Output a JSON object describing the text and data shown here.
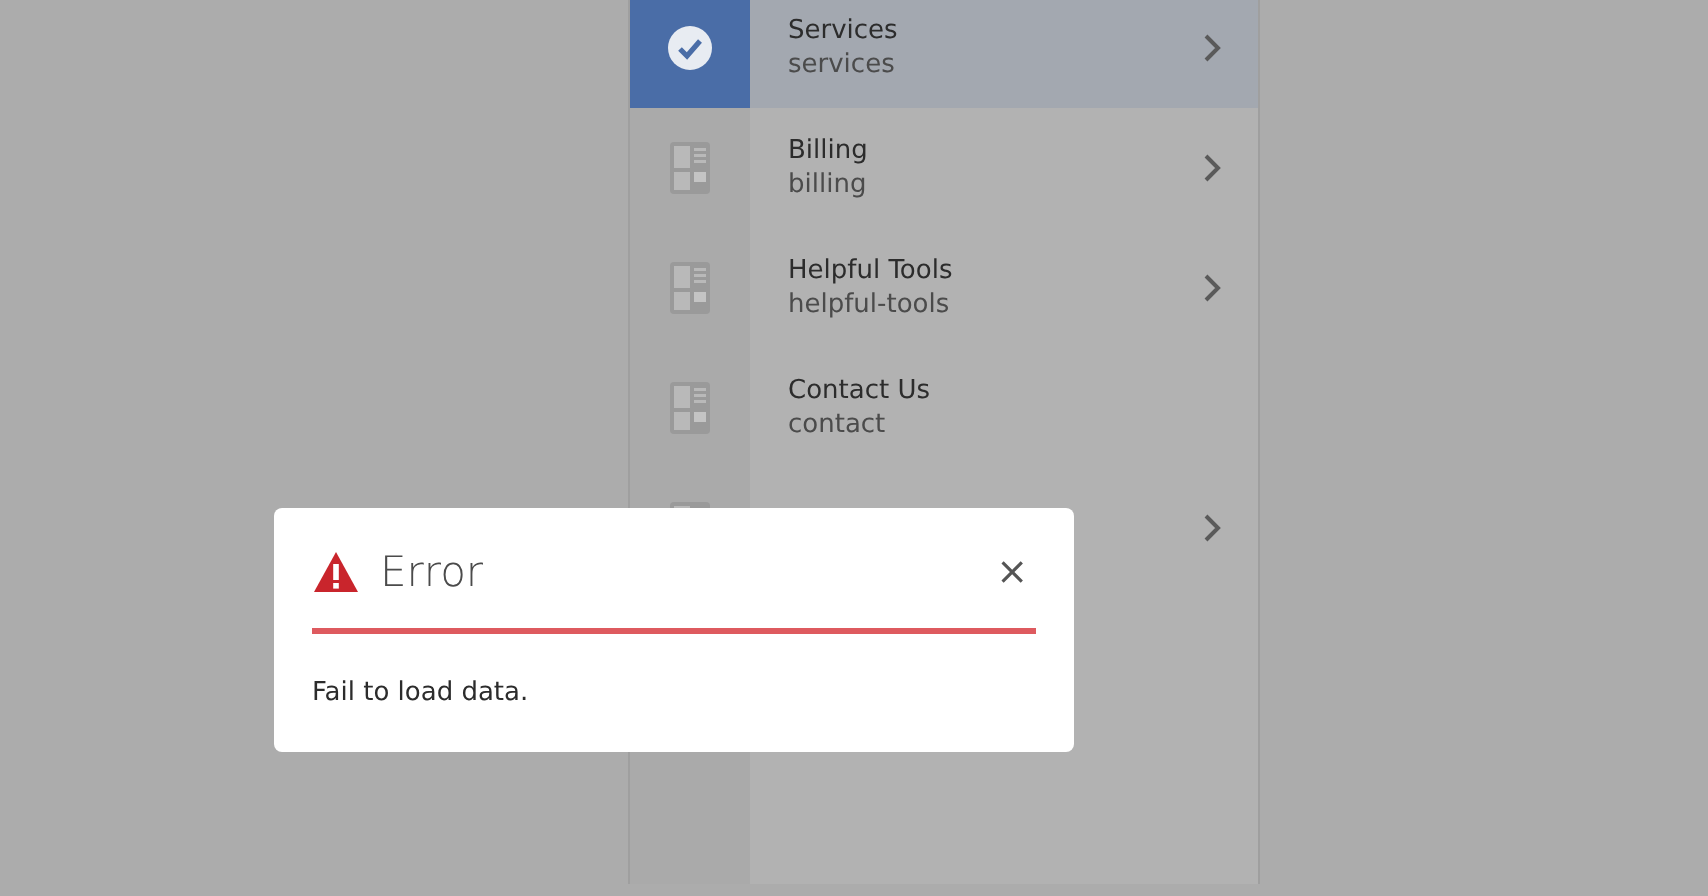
{
  "column_items": [
    {
      "title": "Services",
      "name": "services",
      "selected": true,
      "has_children": true
    },
    {
      "title": "Billing",
      "name": "billing",
      "selected": false,
      "has_children": true
    },
    {
      "title": "Helpful Tools",
      "name": "helpful-tools",
      "selected": false,
      "has_children": true
    },
    {
      "title": "Contact Us",
      "name": "contact",
      "selected": false,
      "has_children": false
    },
    {
      "selected": false,
      "has_children": true
    }
  ],
  "dialog": {
    "title": "Error",
    "message": "Fail to load data.",
    "close": "×"
  }
}
